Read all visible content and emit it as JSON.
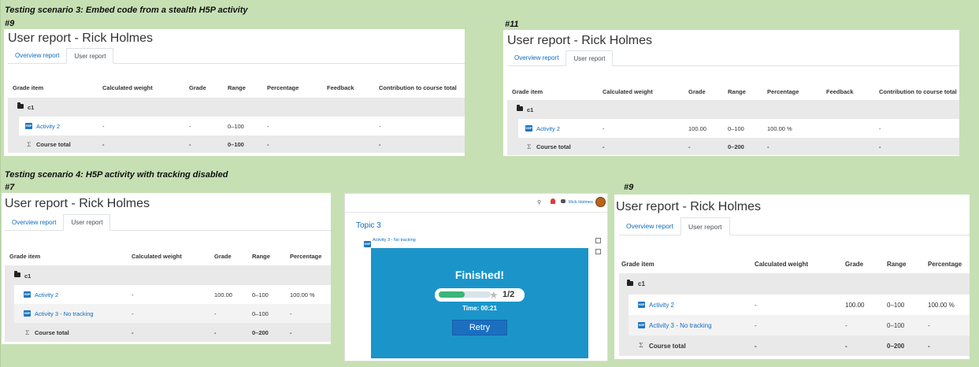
{
  "headings": {
    "scenario3": "Testing scenario 3: Embed code from a stealth H5P activity",
    "scenario4": "Testing scenario 4: H5P activity with tracking disabled",
    "p1_num": "#9",
    "p2_num": "#11",
    "p3_num": "#7",
    "p5_num": "#9"
  },
  "report": {
    "title": "User report - Rick Holmes",
    "tab_overview": "Overview report",
    "tab_user": "User report",
    "cols": {
      "grade_item": "Grade item",
      "weight": "Calculated weight",
      "grade": "Grade",
      "range": "Range",
      "percentage": "Percentage",
      "feedback": "Feedback",
      "contribution": "Contribution to course total"
    },
    "category": "c1",
    "course_total": "Course total",
    "activity2": "Activity 2",
    "activity3": "Activity 3 - No tracking"
  },
  "panel1": {
    "a2": {
      "weight": "-",
      "grade": "-",
      "range": "0–100",
      "pct": "-",
      "contrib": "-"
    },
    "total": {
      "weight": "-",
      "grade": "-",
      "range": "0–100",
      "pct": "-",
      "contrib": "-"
    }
  },
  "panel2": {
    "a2": {
      "weight": "-",
      "grade": "100.00",
      "range": "0–100",
      "pct": "100.00 %",
      "contrib": "-"
    },
    "total": {
      "weight": "-",
      "grade": "-",
      "range": "0–200",
      "pct": "-",
      "contrib": "-"
    }
  },
  "panel3": {
    "a2": {
      "weight": "-",
      "grade": "100.00",
      "range": "0–100",
      "pct": "100.00 %"
    },
    "a3": {
      "weight": "-",
      "grade": "-",
      "range": "0–100",
      "pct": "-"
    },
    "total": {
      "weight": "-",
      "grade": "-",
      "range": "0–200",
      "pct": "-"
    }
  },
  "panel5": {
    "a2": {
      "weight": "-",
      "grade": "100.00",
      "range": "0–100",
      "pct": "100.00 %"
    },
    "a3": {
      "weight": "-",
      "grade": "-",
      "range": "0–100",
      "pct": "-"
    },
    "total": {
      "weight": "-",
      "grade": "-",
      "range": "0–200",
      "pct": "-"
    }
  },
  "course_page": {
    "user_name": "Rick Holmes",
    "topic": "Topic 3",
    "activity_link": "Activity 3 - No tracking",
    "h5p": {
      "finished": "Finished!",
      "score": "1/2",
      "score_fraction": 0.5,
      "time": "Time: 00:21",
      "retry": "Retry"
    }
  },
  "colors": {
    "background": "#c6e0b4",
    "link": "#0f6cbf",
    "h5p_bg": "#1b95c9",
    "progress": "#3ab67a",
    "retry": "#1a6fc1"
  }
}
